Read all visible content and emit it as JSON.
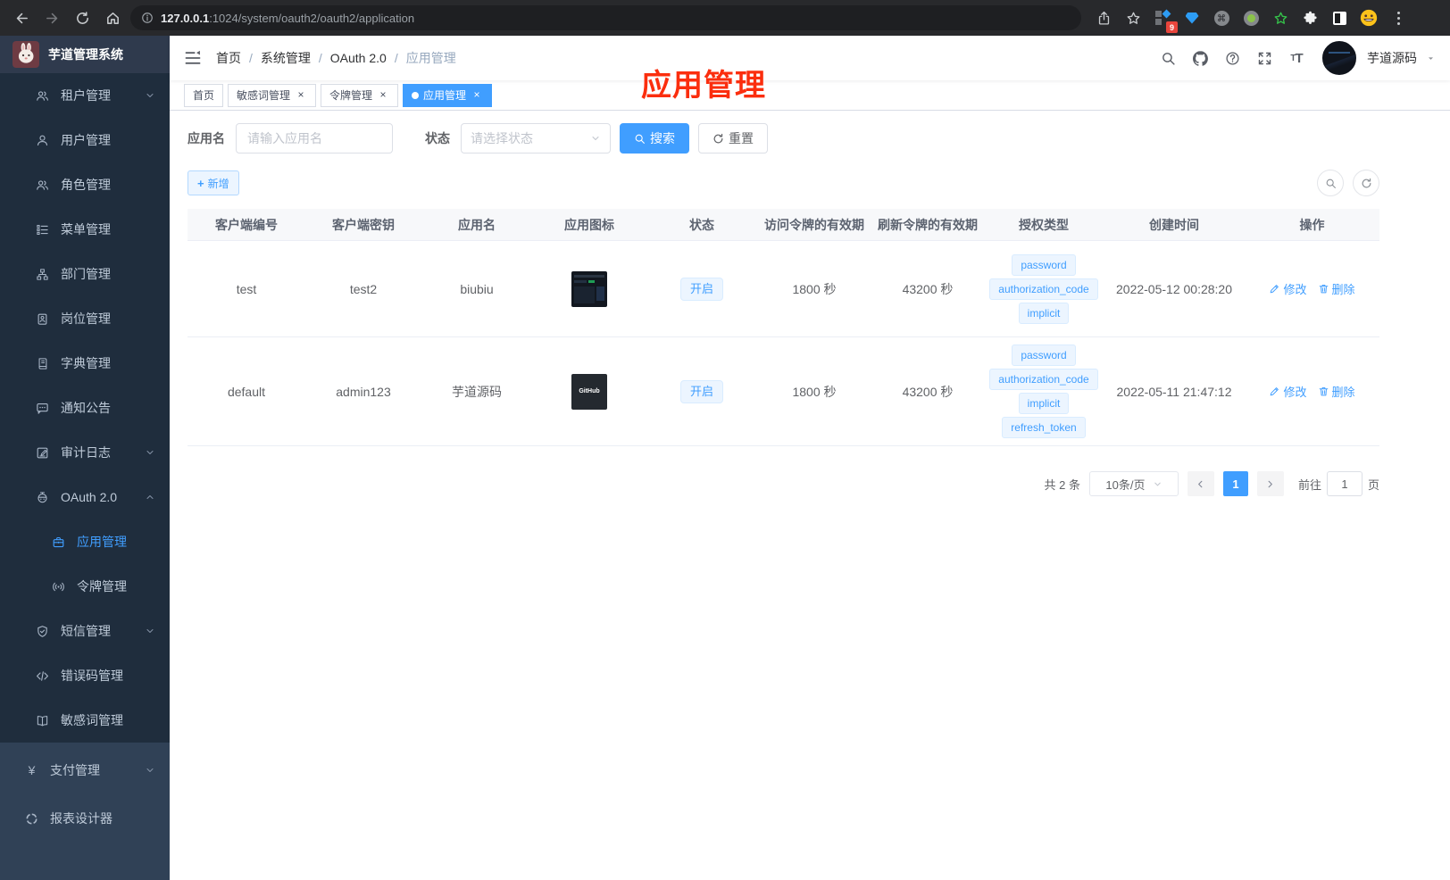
{
  "browser": {
    "url_host": "127.0.0.1",
    "url_rest": ":1024/system/oauth2/oauth2/application",
    "extension_badge": "9"
  },
  "sidebar": {
    "title": "芋道管理系统",
    "items": [
      {
        "label": "租户管理"
      },
      {
        "label": "用户管理"
      },
      {
        "label": "角色管理"
      },
      {
        "label": "菜单管理"
      },
      {
        "label": "部门管理"
      },
      {
        "label": "岗位管理"
      },
      {
        "label": "字典管理"
      },
      {
        "label": "通知公告"
      },
      {
        "label": "审计日志"
      },
      {
        "label": "OAuth 2.0"
      },
      {
        "label": "应用管理"
      },
      {
        "label": "令牌管理"
      },
      {
        "label": "短信管理"
      },
      {
        "label": "错误码管理"
      },
      {
        "label": "敏感词管理"
      },
      {
        "label": "支付管理"
      },
      {
        "label": "报表设计器"
      }
    ]
  },
  "navbar": {
    "breadcrumb": {
      "home": "首页",
      "system": "系统管理",
      "oauth": "OAuth 2.0",
      "current": "应用管理"
    },
    "username": "芋道源码"
  },
  "tabs": {
    "t0": "首页",
    "t1": "敏感词管理",
    "t2": "令牌管理",
    "t3": "应用管理"
  },
  "annotation": {
    "text": "应用管理",
    "color": "#fb2e0e"
  },
  "filters": {
    "name_label": "应用名",
    "name_placeholder": "请输入应用名",
    "status_label": "状态",
    "status_placeholder": "请选择状态",
    "search": "搜索",
    "reset": "重置",
    "add": "新增"
  },
  "table": {
    "columns": [
      "客户端编号",
      "客户端密钥",
      "应用名",
      "应用图标",
      "状态",
      "访问令牌的有效期",
      "刷新令牌的有效期",
      "授权类型",
      "创建时间",
      "操作"
    ],
    "rows": [
      {
        "client_id": "test",
        "client_secret": "test2",
        "app_name": "biubiu",
        "icon": "dashboard-screenshot",
        "icon_text": "",
        "status": "开启",
        "access_token_ttl": "1800 秒",
        "refresh_token_ttl": "43200 秒",
        "grant_types": [
          "password",
          "authorization_code",
          "implicit"
        ],
        "created_at": "2022-05-12 00:28:20"
      },
      {
        "client_id": "default",
        "client_secret": "admin123",
        "app_name": "芋道源码",
        "icon": "github-logo",
        "icon_text": "GitHub",
        "status": "开启",
        "access_token_ttl": "1800 秒",
        "refresh_token_ttl": "43200 秒",
        "grant_types": [
          "password",
          "authorization_code",
          "implicit",
          "refresh_token"
        ],
        "created_at": "2022-05-11 21:47:12"
      }
    ],
    "actions": {
      "edit": "修改",
      "delete": "删除"
    }
  },
  "pagination": {
    "total": "共 2 条",
    "page_size": "10条/页",
    "page": "1",
    "goto": "前往",
    "goto_value": "1",
    "unit": "页"
  },
  "colors": {
    "accent": "#409eff",
    "annotation_red": "#fb2e0e",
    "sidebar_submenu_bg": "#1f2d3d",
    "sidebar_base_bg": "#304156",
    "tag_bg": "#ecf5ff"
  }
}
